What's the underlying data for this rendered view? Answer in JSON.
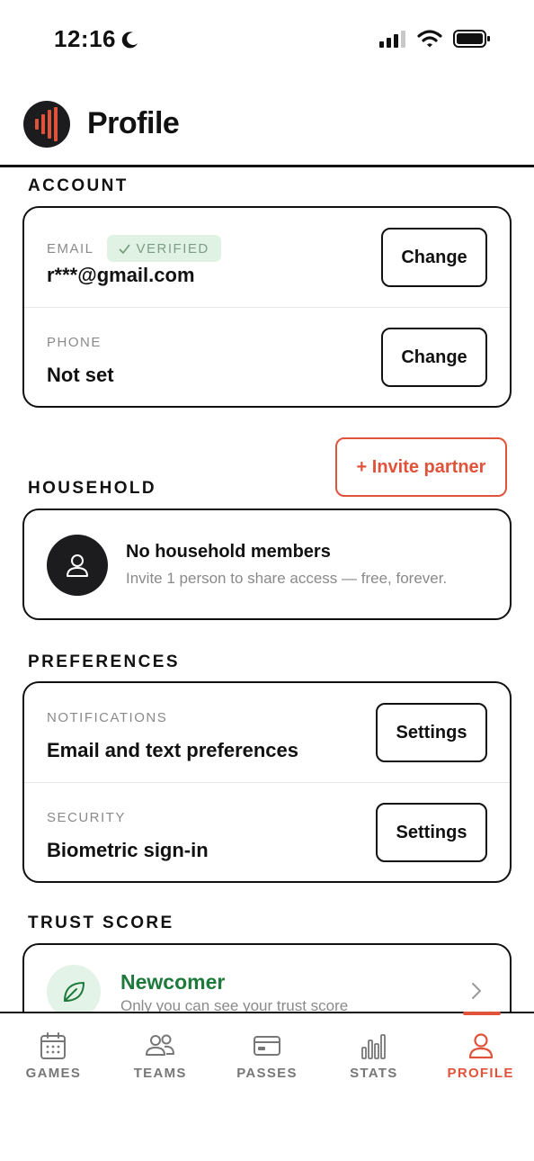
{
  "status_bar": {
    "time": "12:16"
  },
  "header": {
    "title": "Profile"
  },
  "account": {
    "section_title": "ACCOUNT",
    "email": {
      "label": "EMAIL",
      "badge": "VERIFIED",
      "value": "r***@gmail.com",
      "button": "Change"
    },
    "phone": {
      "label": "PHONE",
      "value": "Not set",
      "button": "Change"
    }
  },
  "household": {
    "section_title": "HOUSEHOLD",
    "invite_button": "+ Invite partner",
    "title": "No household members",
    "subtitle": "Invite 1 person to share access — free, forever."
  },
  "preferences": {
    "section_title": "PREFERENCES",
    "notifications": {
      "label": "NOTIFICATIONS",
      "value": "Email and text preferences",
      "button": "Settings"
    },
    "security": {
      "label": "SECURITY",
      "value": "Biometric sign-in",
      "button": "Settings"
    }
  },
  "trust": {
    "section_title": "TRUST SCORE",
    "level": "Newcomer",
    "subtitle": "Only you can see your trust score"
  },
  "tabs": [
    {
      "label": "GAMES",
      "icon": "calendar-icon"
    },
    {
      "label": "TEAMS",
      "icon": "users-icon"
    },
    {
      "label": "PASSES",
      "icon": "card-icon"
    },
    {
      "label": "STATS",
      "icon": "bar-chart-icon"
    },
    {
      "label": "PROFILE",
      "icon": "user-icon",
      "active": true
    }
  ],
  "colors": {
    "accent": "#e0533a",
    "green": "#1e7a3c",
    "verified_bg": "#dff2e3"
  }
}
